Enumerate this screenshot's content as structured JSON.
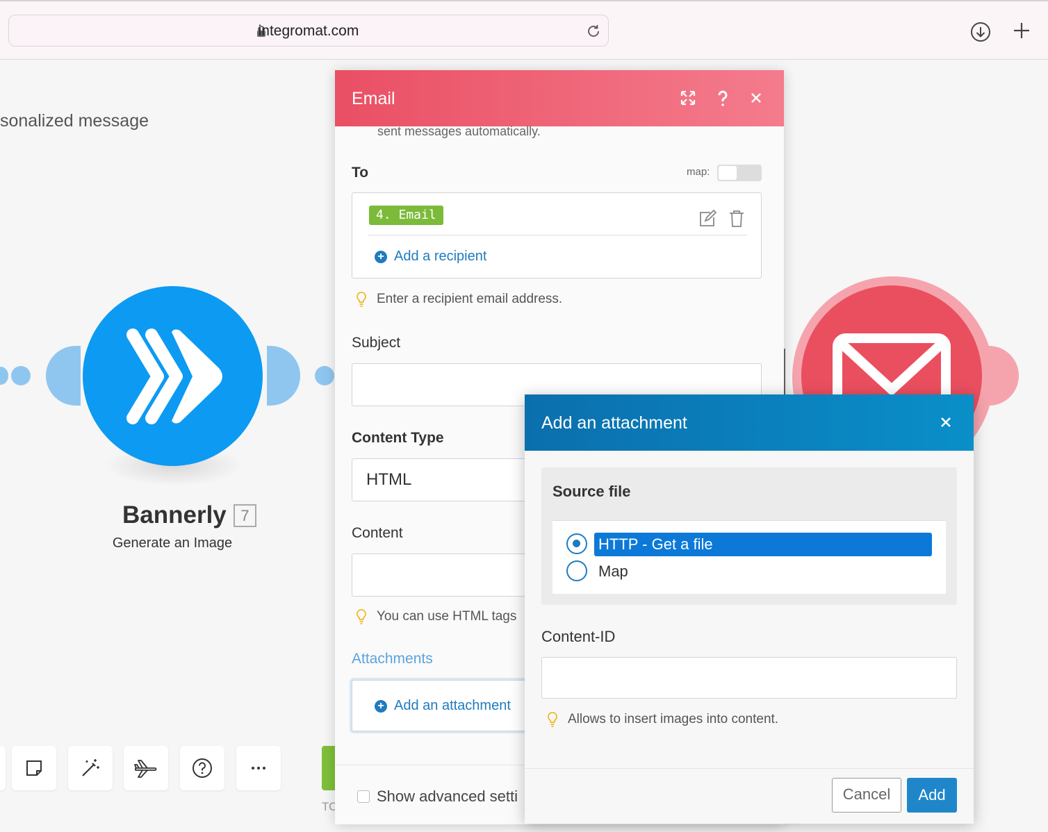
{
  "browser": {
    "url": "integromat.com"
  },
  "canvas": {
    "background_text": "sonalized message",
    "module_left": {
      "name": "Bannerly",
      "badge": "7",
      "subtitle": "Generate an Image",
      "color": "#0d9af2"
    },
    "module_right": {
      "color": "#ea4f5f"
    },
    "bottom_cut_text": "TO"
  },
  "email_dialog": {
    "title": "Email",
    "cut_text": "sent messages automatically.",
    "to": {
      "label": "To",
      "map_label": "map:",
      "pill": "4. Email",
      "add_recipient": "Add a recipient",
      "hint": "Enter a recipient email address."
    },
    "subject": {
      "label": "Subject",
      "value": ""
    },
    "content_type": {
      "label": "Content Type",
      "value": "HTML"
    },
    "content": {
      "label": "Content",
      "value": "",
      "hint": "You can use HTML tags"
    },
    "attachments": {
      "label": "Attachments",
      "add_label": "Add an attachment"
    },
    "advanced": "Show advanced setti"
  },
  "attachment_dialog": {
    "title": "Add an attachment",
    "source_label": "Source file",
    "options": [
      "HTTP - Get a file",
      "Map"
    ],
    "selected": "HTTP - Get a file",
    "content_id": {
      "label": "Content-ID",
      "value": "",
      "hint": "Allows to insert images into content."
    },
    "cancel": "Cancel",
    "add": "Add"
  },
  "colors": {
    "email_header": "#ea4f64",
    "attachment_header": "#0b6fad",
    "link": "#1f7bbf",
    "pill": "#7cba3a"
  }
}
